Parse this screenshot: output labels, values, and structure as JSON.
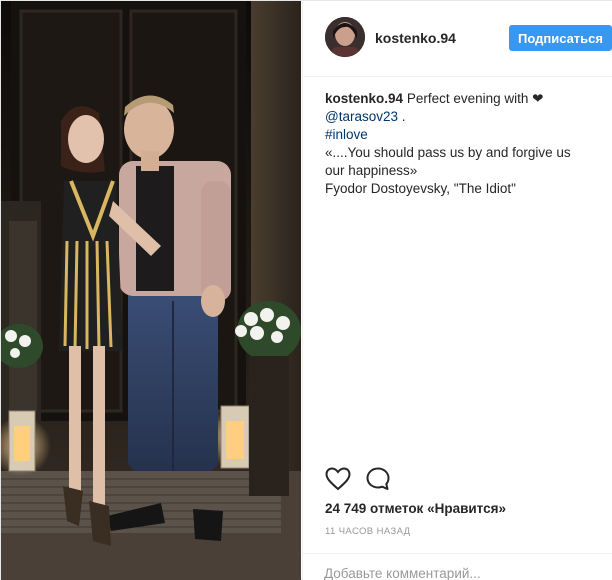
{
  "post": {
    "username": "kostenko.94",
    "follow_label": "Подписаться",
    "caption": {
      "username": "kostenko.94",
      "text_start": "Perfect evening with",
      "heart": "❤",
      "mention": "@tarasov23",
      "mention_suffix": " .",
      "hashtag": "#inlove",
      "quote_line1": "«....You should pass us by and forgive us",
      "quote_line2": "our happiness»",
      "attribution": "Fyodor Dostoyevsky, \"The Idiot\""
    },
    "likes_text": "24 749 отметок «Нравится»",
    "timestamp": "11 ЧАСОВ НАЗАД",
    "comment_placeholder": "Добавьте комментарий..."
  },
  "colors": {
    "follow_button": "#3897f0",
    "link": "#003569",
    "muted": "#999999",
    "text": "#262626"
  },
  "icons": {
    "like": "heart-outline-icon",
    "comment": "speech-bubble-icon"
  }
}
